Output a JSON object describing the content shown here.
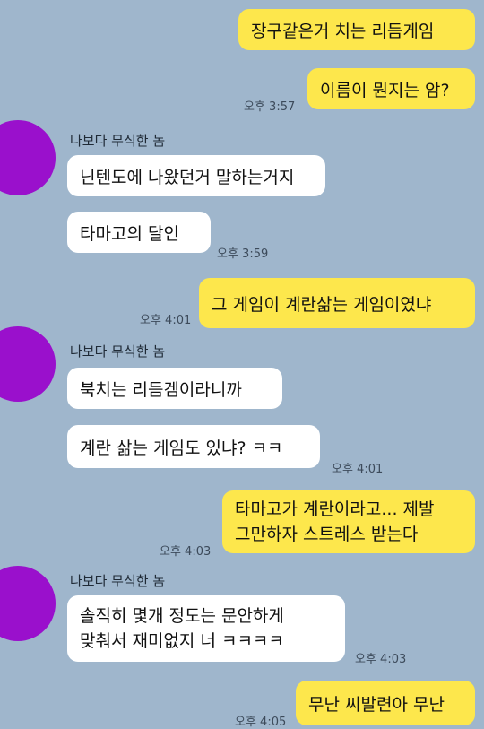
{
  "messages": [
    {
      "id": "m1",
      "side": "me",
      "text": "장구같은거 치는 리듬게임"
    },
    {
      "id": "m2",
      "side": "me",
      "text": "이름이 뭔지는 암?",
      "time": "오후 3:57"
    },
    {
      "id": "s1",
      "sender": "나보다 무식한 놈"
    },
    {
      "id": "m3",
      "side": "other",
      "text": "닌텐도에 나왔던거 말하는거지"
    },
    {
      "id": "m4",
      "side": "other",
      "text": "타마고의 달인",
      "time": "오후 3:59"
    },
    {
      "id": "m5",
      "side": "me",
      "text": "그 게임이 계란삶는 게임이였냐",
      "time": "오후 4:01"
    },
    {
      "id": "s2",
      "sender": "나보다 무식한 놈"
    },
    {
      "id": "m6",
      "side": "other",
      "text": "북치는 리듬겜이라니까"
    },
    {
      "id": "m7",
      "side": "other",
      "text": "계란 삶는 게임도 있냐? ㅋㅋ",
      "time": "오후 4:01"
    },
    {
      "id": "m8",
      "side": "me",
      "lines": [
        "타마고가 계란이라고... 제발",
        "그만하자 스트레스 받는다"
      ],
      "time": "오후 4:03"
    },
    {
      "id": "s3",
      "sender": "나보다 무식한 놈"
    },
    {
      "id": "m9",
      "side": "other",
      "lines": [
        "솔직히 몇개 정도는 문안하게",
        "맞춰서 재미없지 너 ㅋㅋㅋㅋ"
      ],
      "time": "오후 4:03"
    },
    {
      "id": "m10",
      "side": "me",
      "text": "무난 씨발련아 무난",
      "time": "오후 4:05"
    }
  ],
  "colors": {
    "background": "#9fb6cc",
    "my_bubble": "#fde74c",
    "their_bubble": "#ffffff",
    "avatar": "#9a10cc"
  }
}
